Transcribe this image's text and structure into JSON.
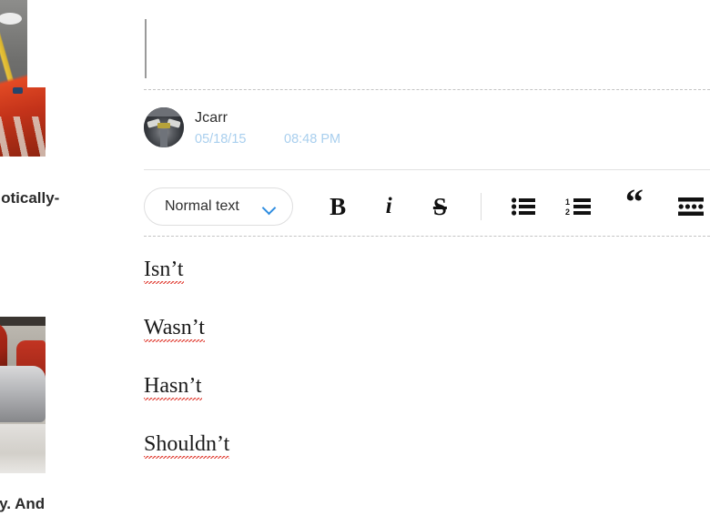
{
  "left_column": {
    "images": [
      {
        "name": "photo-road-with-red-car",
        "alt": "Red sports car on a road, partially cut off at left edge"
      },
      {
        "name": "photo-garage-with-cars",
        "alt": "Red and silver cars parked in a garage, partially cut off at left edge"
      }
    ],
    "text_fragments": [
      {
        "name": "fragment-idiotically",
        "text": "diotically-"
      },
      {
        "name": "fragment-bly-and",
        "text": "bly. And"
      }
    ]
  },
  "post": {
    "author": "Jcarr",
    "date": "05/18/15",
    "time": "08:48 PM",
    "avatar_alt": "Jcarr avatar, dark photo of a car front"
  },
  "toolbar": {
    "style_select": {
      "value": "Normal text",
      "chevron_icon": "chevron-down-icon",
      "chevron_color": "#2f8de0"
    },
    "buttons": [
      {
        "name": "bold-button",
        "glyph": "B",
        "icon": "bold-icon",
        "title": "Bold"
      },
      {
        "name": "italic-button",
        "glyph": "i",
        "icon": "italic-icon",
        "title": "Italic"
      },
      {
        "name": "strikethrough-button",
        "glyph": "S",
        "icon": "strikethrough-icon",
        "title": "Strikethrough"
      },
      {
        "name": "bulleted-list-button",
        "glyph": "",
        "icon": "bulleted-list-icon",
        "title": "Bulleted list"
      },
      {
        "name": "numbered-list-button",
        "glyph": "",
        "icon": "numbered-list-icon",
        "title": "Numbered list"
      },
      {
        "name": "quote-button",
        "glyph": "“",
        "icon": "quote-icon",
        "title": "Quote"
      },
      {
        "name": "code-block-button",
        "glyph": "",
        "icon": "code-block-icon",
        "title": "Code block"
      }
    ]
  },
  "editor": {
    "lines": [
      "Isn’t",
      "Wasn’t",
      "Hasn’t",
      "Shouldn’t"
    ]
  },
  "colors": {
    "accent_blue": "#2f8de0",
    "timestamp_blue": "#a9cfee",
    "text_dark": "#1a1a1a",
    "spellcheck_red": "#e03a2f",
    "divider_gray": "#c4c4c4",
    "background": "#ffffff"
  }
}
